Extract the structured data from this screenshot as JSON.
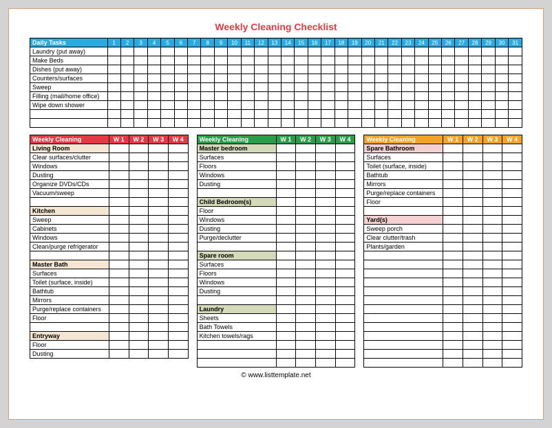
{
  "title": "Weekly Cleaning Checklist",
  "footer": "© www.listtemplate.net",
  "daily": {
    "header": "Daily Tasks",
    "days": [
      "1",
      "2",
      "3",
      "4",
      "5",
      "6",
      "7",
      "8",
      "9",
      "10",
      "11",
      "12",
      "13",
      "14",
      "15",
      "16",
      "17",
      "18",
      "19",
      "20",
      "21",
      "22",
      "23",
      "24",
      "25",
      "26",
      "27",
      "28",
      "29",
      "30",
      "31"
    ],
    "tasks": [
      "Laundry (put away)",
      "Make Beds",
      "Dishes (put away)",
      "Counters/surfaces",
      "Sweep",
      "Filling (mail/home office)",
      "Wipe down shower"
    ],
    "spacer_rows": 2
  },
  "weekly_header": "Weekly Cleaning",
  "week_cols": [
    "W 1",
    "W 2",
    "W 3",
    "W 4"
  ],
  "col1": {
    "sections": [
      {
        "name": "Living Room",
        "cls": "sec-beige",
        "items": [
          "Clear surfaces/clutter",
          "Windows",
          "Dusting",
          "Organize DVDs/CDs",
          "Vacuum/sweep"
        ],
        "after_blank": 1
      },
      {
        "name": "Kitchen",
        "cls": "sec-beige",
        "items": [
          "Sweep",
          "Cabinets",
          "Windows",
          "Clean/purge refrigerator"
        ],
        "after_blank": 1
      },
      {
        "name": "Master Bath",
        "cls": "sec-beige",
        "items": [
          "Surfaces",
          "Toilet (surface, inside)",
          "Bathtub",
          "Mirrors",
          "Purge/replace containers",
          "Floor"
        ],
        "after_blank": 1
      },
      {
        "name": "Entryway",
        "cls": "sec-beige",
        "items": [
          "Floor",
          "Dusting"
        ],
        "after_blank": 0
      }
    ],
    "extra_rows": 0
  },
  "col2": {
    "sections": [
      {
        "name": "Master bedroom",
        "cls": "sec-olive",
        "items": [
          "Surfaces",
          "Floors",
          "Windows",
          "Dusting"
        ],
        "after_blank": 1
      },
      {
        "name": "Child Bedroom(s)",
        "cls": "sec-olive",
        "items": [
          "Floor",
          "Windows",
          "Dusting",
          "Purge/declutter"
        ],
        "after_blank": 1
      },
      {
        "name": "Spare room",
        "cls": "sec-olive",
        "items": [
          "Surfaces",
          "Floors",
          "Windows",
          "Dusting"
        ],
        "after_blank": 1
      },
      {
        "name": "Laundry",
        "cls": "sec-olive",
        "items": [
          "Sheets",
          "Bath Towels",
          "Kitchen towels/rags"
        ],
        "after_blank": 0
      }
    ],
    "extra_rows": 3
  },
  "col3": {
    "sections": [
      {
        "name": "Spare Bathroom",
        "cls": "sec-pink",
        "items": [
          "Surfaces",
          "Toilet (surface, inside)",
          "Bathtub",
          "Mirrors",
          "Purge/replace containers",
          "Floor"
        ],
        "after_blank": 1
      },
      {
        "name": "Yard(s)",
        "cls": "sec-pink",
        "items": [
          "Sweep porch",
          "Clear clutter/trash",
          "Plants/garden"
        ],
        "after_blank": 0
      }
    ],
    "extra_rows": 13
  }
}
